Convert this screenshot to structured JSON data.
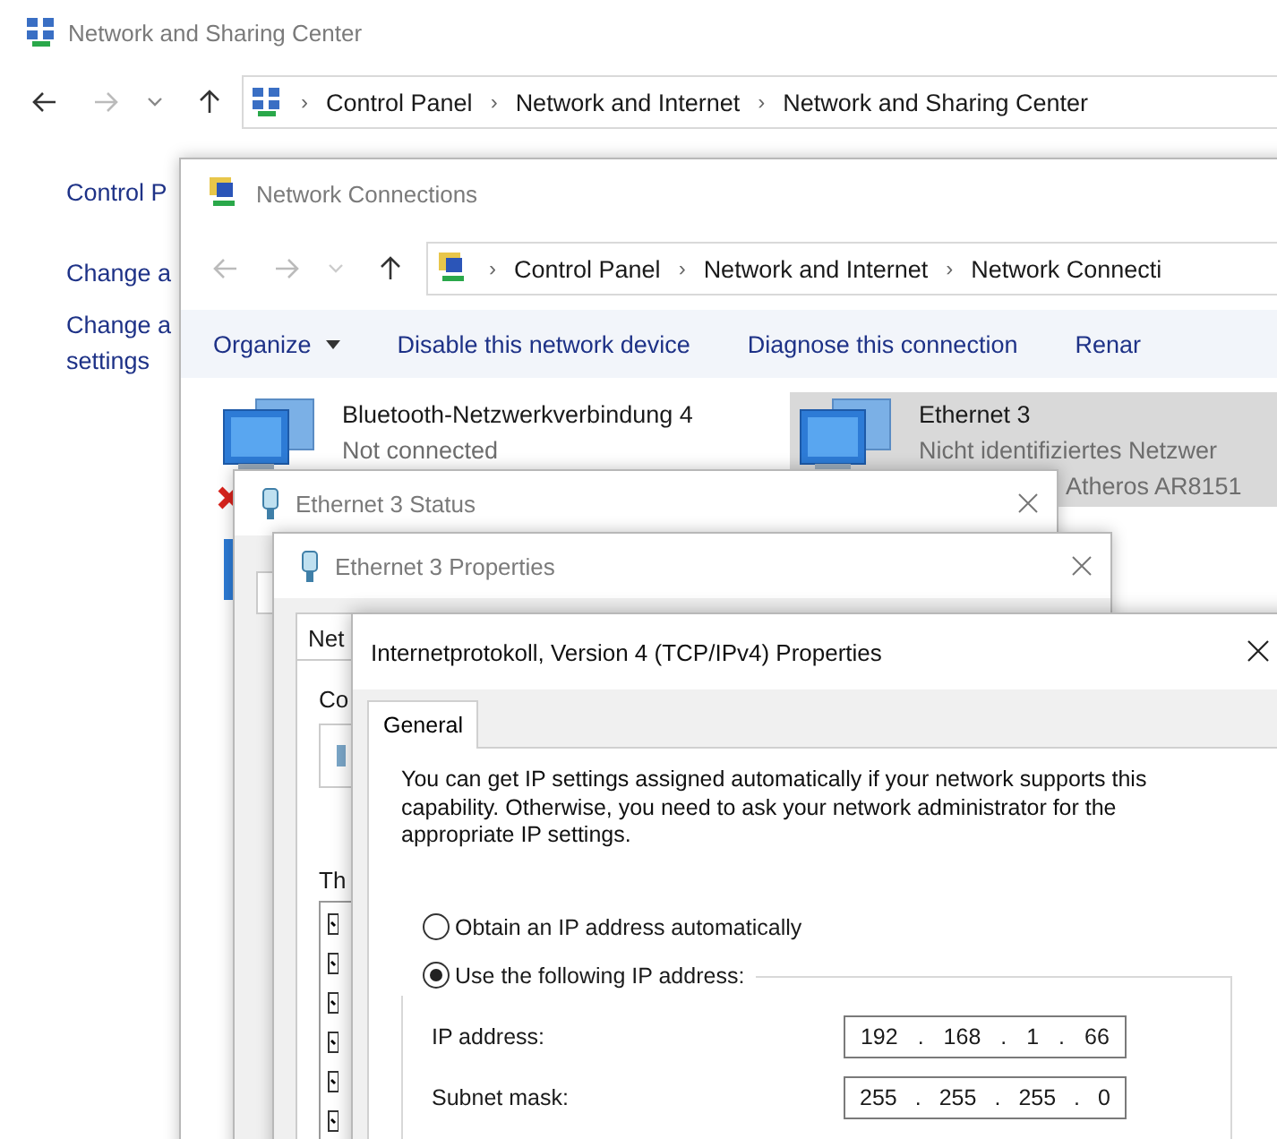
{
  "window": {
    "title": "Network and Sharing Center"
  },
  "address_bar": {
    "crumbs": [
      "Control Panel",
      "Network and Internet",
      "Network and Sharing Center"
    ],
    "separator": "›"
  },
  "sidebar": {
    "items": [
      {
        "lines": [
          "Control P"
        ]
      },
      {
        "lines": [
          "Change a"
        ]
      },
      {
        "lines": [
          "Change a",
          "settings"
        ]
      }
    ]
  },
  "network_connections": {
    "title": "Network Connections",
    "crumbs": [
      "Control Panel",
      "Network and Internet",
      "Network Connecti"
    ],
    "separator": "›",
    "toolbar": [
      {
        "label": "Organize",
        "dropdown": true
      },
      {
        "label": "Disable this network device",
        "dropdown": false
      },
      {
        "label": "Diagnose this connection",
        "dropdown": false
      },
      {
        "label": "Renar",
        "dropdown": false
      }
    ],
    "adapters": [
      {
        "name": "Bluetooth-Netzwerkverbindung 4",
        "lines": [
          {
            "text": "Not connected",
            "kind": "status"
          }
        ],
        "selected": false,
        "disconnected": true
      },
      {
        "name": "Ethernet 3",
        "lines": [
          {
            "text": "Nicht identifiziertes Netzwer",
            "kind": "status"
          },
          {
            "text": "Atheros AR8151",
            "kind": "device"
          }
        ],
        "selected": true,
        "disconnected": false
      }
    ]
  },
  "status_window": {
    "title": "Ethernet 3 Status"
  },
  "properties_window": {
    "title": "Ethernet 3 Properties",
    "tab": "Net",
    "labels": [
      "Co",
      "Th"
    ]
  },
  "ipv4_dialog": {
    "title": "Internetprotokoll, Version 4 (TCP/IPv4) Properties",
    "tabs": [
      {
        "label": "General",
        "selected": true
      }
    ],
    "intro": "You can get IP settings assigned automatically if your network supports this capability. Otherwise, you need to ask your network administrator for the appropriate IP settings.",
    "options": [
      {
        "label": "Obtain an IP address automatically",
        "selected": false
      },
      {
        "label": "Use the following IP address:",
        "selected": true
      }
    ],
    "octet_separator": ".",
    "fields": [
      {
        "label": "IP address:",
        "octets": [
          "192",
          "168",
          "1",
          "66"
        ]
      },
      {
        "label": "Subnet mask:",
        "octets": [
          "255",
          "255",
          "255",
          "0"
        ]
      }
    ]
  }
}
